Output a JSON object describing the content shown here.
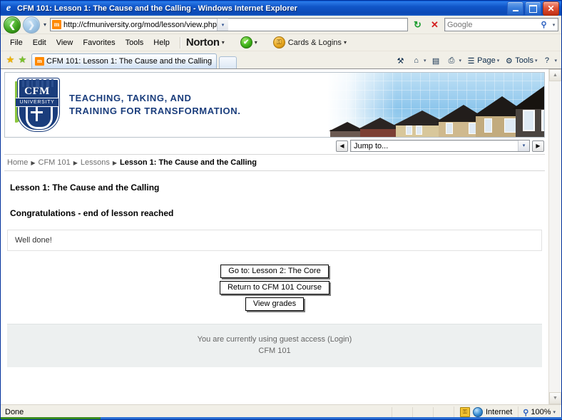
{
  "window": {
    "title": "CFM 101: Lesson 1: The Cause and the Calling - Windows Internet Explorer",
    "icon_glyph": "e",
    "minimize_label": "Minimize",
    "maximize_label": "Restore",
    "close_label": "Close"
  },
  "address_bar": {
    "back_label": "Back",
    "forward_label": "Forward",
    "history_caret": "▾",
    "favicon_text": "m",
    "url": "http://cfmuniversity.org/mod/lesson/view.php",
    "url_dropdown": "▾",
    "refresh_glyph": "↻",
    "stop_glyph": "✕",
    "search_placeholder": "Google",
    "search_value": "",
    "search_go_glyph": "⚲",
    "search_caret": "▾"
  },
  "menu": {
    "items": [
      "File",
      "Edit",
      "View",
      "Favorites",
      "Tools",
      "Help"
    ],
    "norton_label": "Norton",
    "norton_caret": "▾",
    "norton_check_glyph": "✔",
    "norton_check_caret": "▾",
    "cards_logins_label": "Cards & Logins",
    "cards_lock_glyph": "⚿",
    "cards_caret": "▾"
  },
  "tabs": {
    "favorites_add_glyph": "★",
    "favorites_bar_glyph": "★",
    "items": [
      {
        "favicon_text": "m",
        "label": "CFM 101: Lesson 1: The Cause and the Calling",
        "active": true
      }
    ],
    "new_tab_label": ""
  },
  "command_bar": {
    "items": [
      {
        "name": "research",
        "glyph": "⚒",
        "label": "",
        "caret": ""
      },
      {
        "name": "home",
        "glyph": "⌂",
        "label": "",
        "caret": "▾"
      },
      {
        "name": "feeds",
        "glyph": "▤",
        "label": "",
        "caret": ""
      },
      {
        "name": "print",
        "glyph": "⎙",
        "label": "",
        "caret": "▾"
      },
      {
        "name": "page",
        "glyph": "☰",
        "label": "Page",
        "caret": "▾"
      },
      {
        "name": "tools",
        "glyph": "⚙",
        "label": "Tools",
        "caret": "▾"
      },
      {
        "name": "help",
        "glyph": "?",
        "label": "",
        "caret": "▾"
      }
    ]
  },
  "banner": {
    "logo": {
      "cfm_text": "CFM",
      "university_text": "UNIVERSITY"
    },
    "tagline_line1": "TEACHING, TAKING, AND",
    "tagline_line2": "TRAINING FOR TRANSFORMATION."
  },
  "jump_to": {
    "prev_glyph": "◀",
    "next_glyph": "▶",
    "selected": "Jump to...",
    "caret": "▾"
  },
  "breadcrumb": {
    "separator": "▶",
    "items": [
      {
        "label": "Home",
        "current": false
      },
      {
        "label": "CFM 101",
        "current": false
      },
      {
        "label": "Lessons",
        "current": false
      },
      {
        "label": "Lesson 1: The Cause and the Calling",
        "current": true
      }
    ]
  },
  "content": {
    "lesson_heading": "Lesson 1: The Cause and the Calling",
    "congrats_heading": "Congratulations - end of lesson reached",
    "well_done_text": "Well done!",
    "buttons": [
      {
        "label": "Go to: Lesson 2: The Core"
      },
      {
        "label": "Return to CFM 101 Course"
      },
      {
        "label": "View grades"
      }
    ]
  },
  "footer": {
    "guest_access_text": "You are currently using guest access (Login)",
    "course_name": "CFM 101"
  },
  "scrollbar": {
    "up_glyph": "▲",
    "down_glyph": "▼"
  },
  "status_bar": {
    "status_text": "Done",
    "zone_label": "Internet",
    "zone_lock_glyph": "⚿",
    "zoom_level": "100%",
    "zoom_glyph": "⚲",
    "zoom_caret": "▾"
  },
  "colors": {
    "titlebar_blue": "#0b49b4",
    "brand_navy": "#1a3d7c",
    "brand_green": "#8cc63f",
    "chrome_beige": "#f1efe7",
    "footer_gray": "#edf0f0"
  }
}
